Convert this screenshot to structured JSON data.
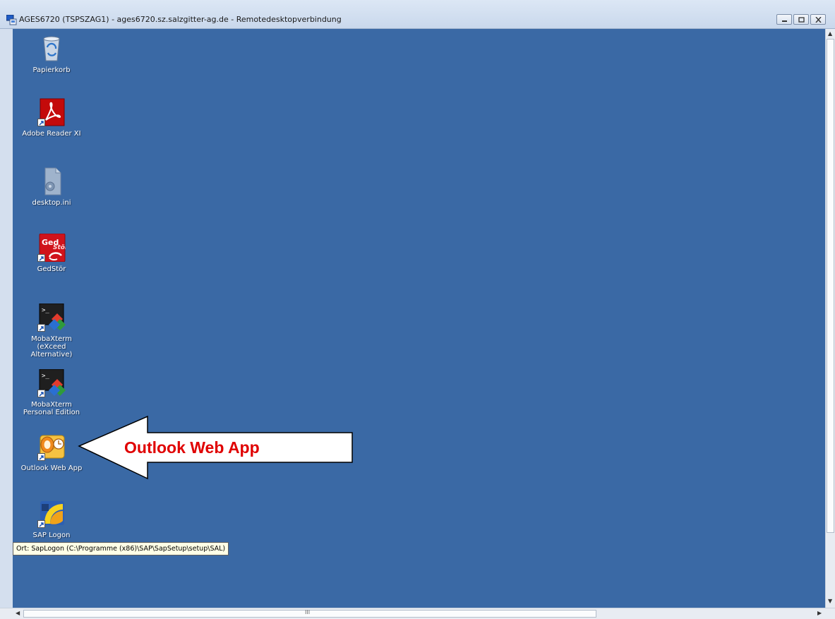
{
  "window": {
    "title": "AGES6720 (TSPSZAG1) - ages6720.sz.salzgitter-ag.de - Remotedesktopverbindung"
  },
  "desktop": {
    "background_color": "#3a69a5",
    "icons": [
      {
        "label": "Papierkorb",
        "icon": "recycle-bin-icon"
      },
      {
        "label": "Adobe Reader XI",
        "icon": "adobe-reader-icon"
      },
      {
        "label": "desktop.ini",
        "icon": "ini-file-icon"
      },
      {
        "label": "GedStör",
        "icon": "gedstoer-icon"
      },
      {
        "label": "MobaXterm (eXceed Alternative)",
        "icon": "mobaxterm-icon"
      },
      {
        "label": "MobaXterm Personal Edition",
        "icon": "mobaxterm-icon"
      },
      {
        "label": "Outlook Web App",
        "icon": "outlook-icon"
      },
      {
        "label": "SAP Logon",
        "icon": "sap-logon-icon"
      }
    ]
  },
  "tooltip": {
    "text": "Ort: SapLogon (C:\\Programme (x86)\\SAP\\SapSetup\\setup\\SAL)"
  },
  "callout": {
    "text": "Outlook Web App",
    "text_color": "#e00000"
  },
  "scrollbar": {
    "grip_glyph": "III"
  }
}
